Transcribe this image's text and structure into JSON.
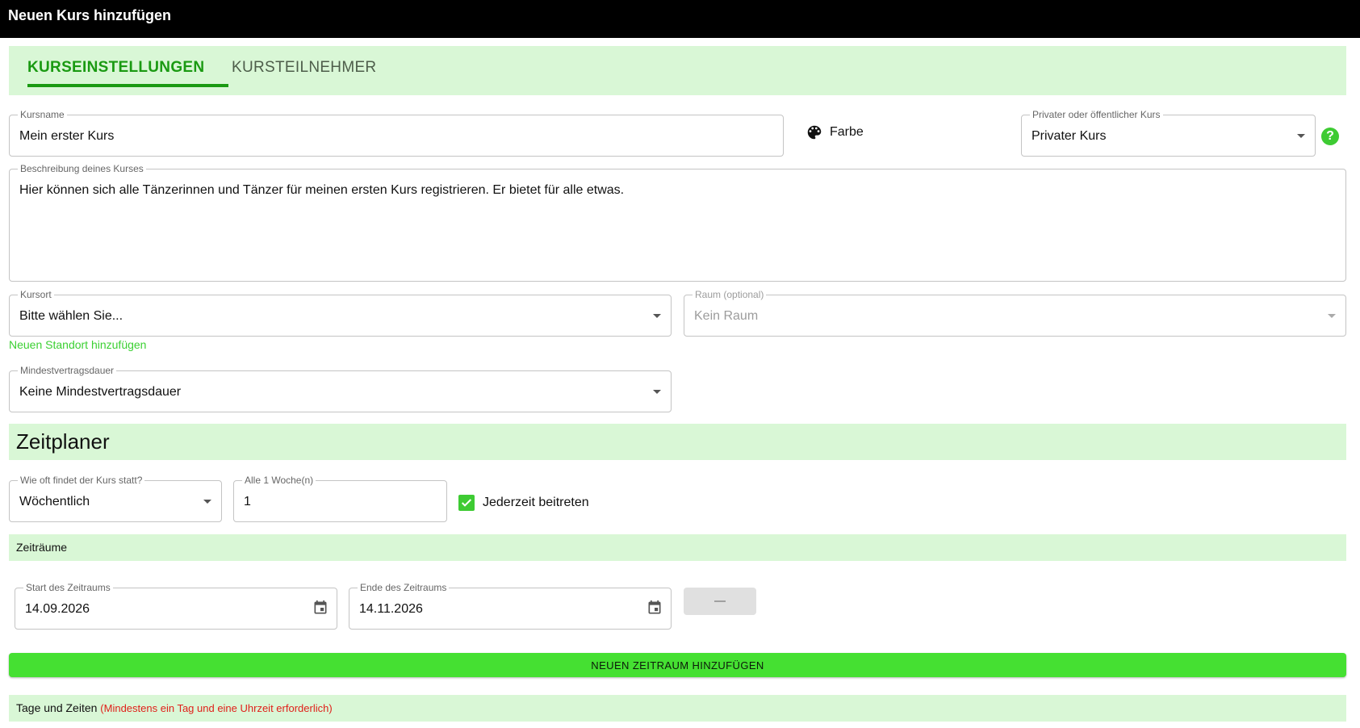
{
  "header": {
    "title": "Neuen Kurs hinzufügen"
  },
  "tabs": [
    {
      "label": "KURSEINSTELLUNGEN",
      "active": true
    },
    {
      "label": "KURSTEILNEHMER",
      "active": false
    }
  ],
  "course": {
    "name_label": "Kursname",
    "name_value": "Mein erster Kurs",
    "color_label": "Farbe",
    "visibility_label": "Privater oder öffentlicher Kurs",
    "visibility_value": "Privater Kurs",
    "description_label": "Beschreibung deines Kurses",
    "description_value": "Hier können sich alle Tänzerinnen und Tänzer für meinen ersten Kurs registrieren. Er bietet für alle etwas.",
    "location_label": "Kursort",
    "location_value": "Bitte wählen Sie...",
    "room_label": "Raum (optional)",
    "room_value": "Kein Raum",
    "add_location_link": "Neuen Standort hinzufügen",
    "min_duration_label": "Mindestvertragsdauer",
    "min_duration_value": "Keine Mindestvertragsdauer"
  },
  "scheduler": {
    "title": "Zeitplaner",
    "frequency_label": "Wie oft findet der Kurs statt?",
    "frequency_value": "Wöchentlich",
    "interval_label": "Alle 1 Woche(n)",
    "interval_value": "1",
    "join_anytime_label": "Jederzeit beitreten",
    "join_anytime_checked": true,
    "periods_title": "Zeiträume",
    "period": {
      "start_label": "Start des Zeitraums",
      "start_value": "14.09.2026",
      "end_label": "Ende des Zeitraums",
      "end_value": "14.11.2026"
    },
    "add_period_button": "NEUEN ZEITRAUM HINZUFÜGEN",
    "days_title": "Tage und Zeiten",
    "days_requirement": "(Mindestens ein Tag und eine Uhrzeit erforderlich)"
  },
  "colors": {
    "accent_green": "#1a9a12",
    "section_bg": "#d9f7d6",
    "button_green": "#45e032",
    "error_red": "#e0201a"
  }
}
